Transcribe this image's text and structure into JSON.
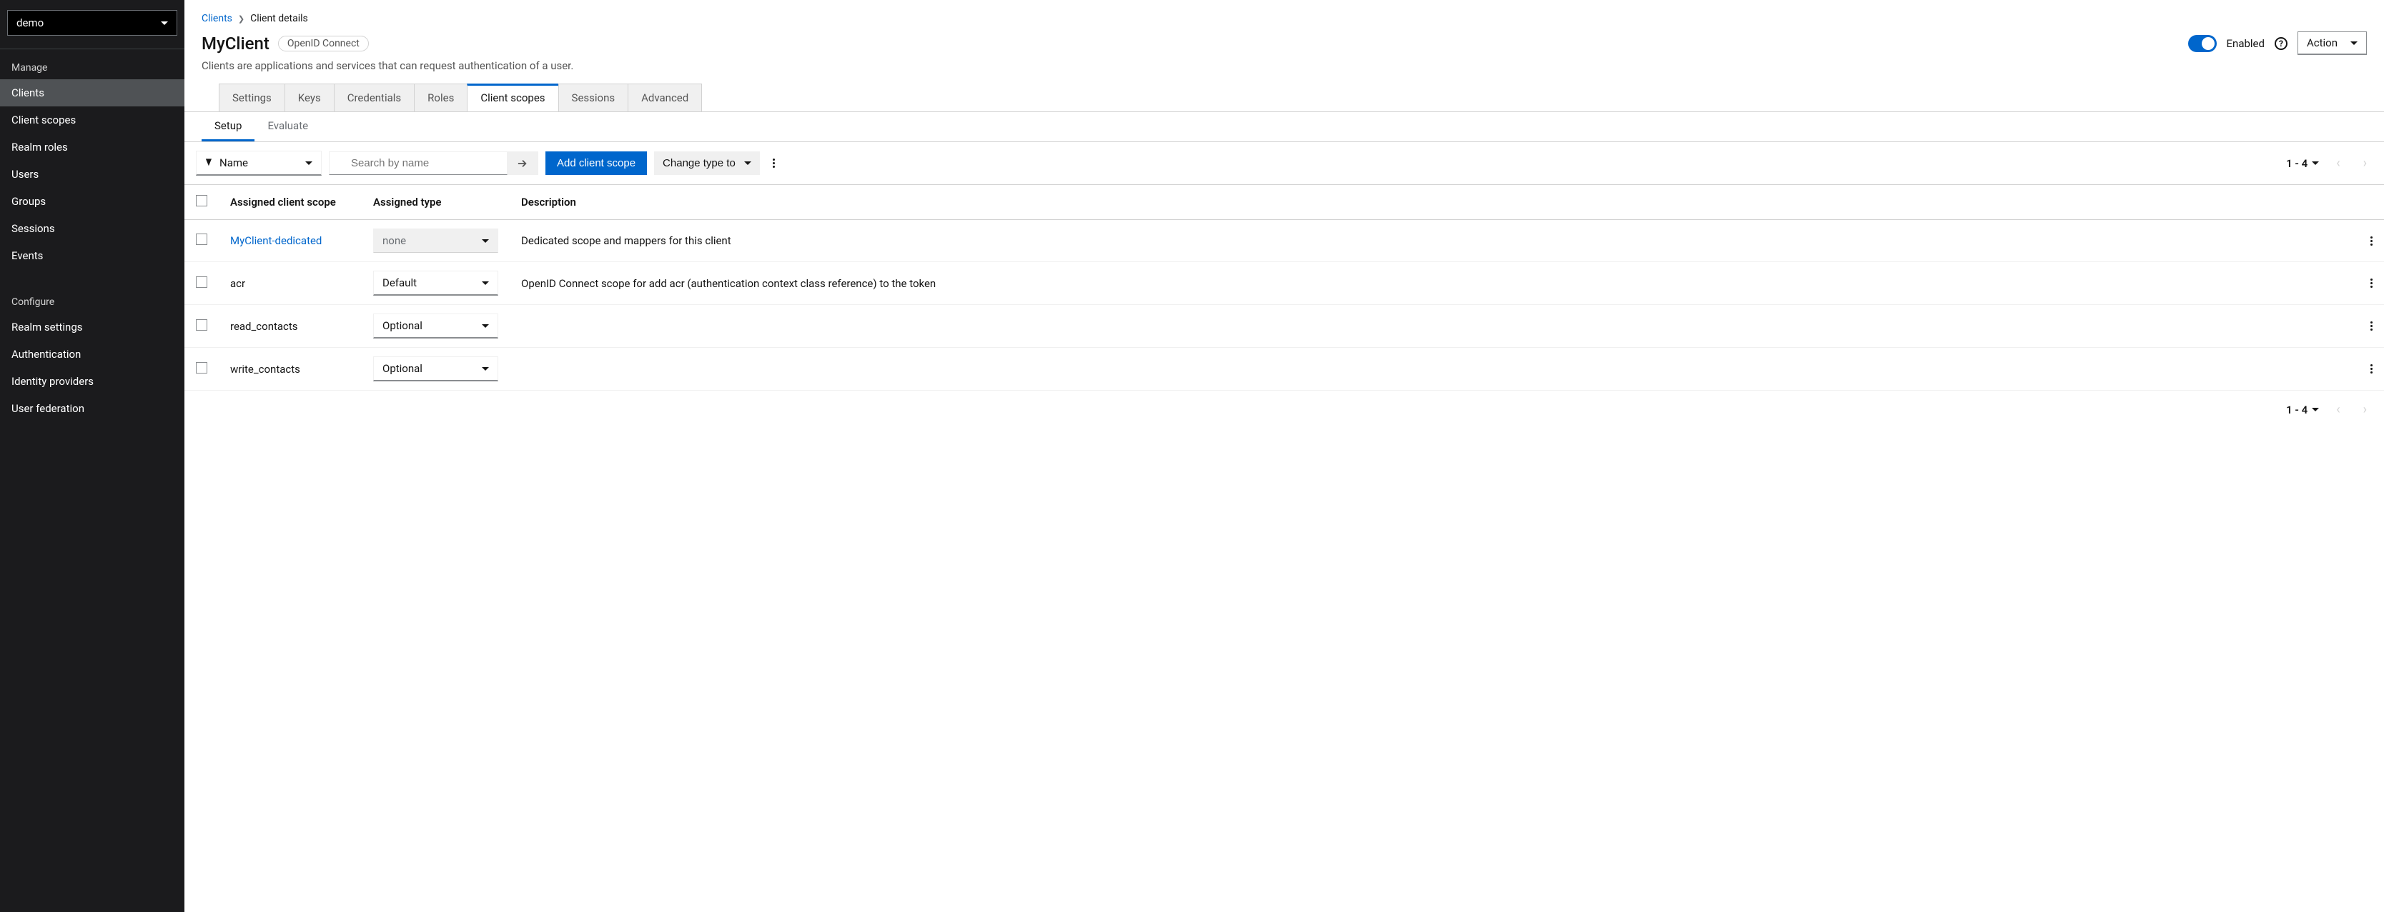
{
  "sidebar": {
    "realm": "demo",
    "sections": {
      "manage": {
        "label": "Manage",
        "items": [
          "Clients",
          "Client scopes",
          "Realm roles",
          "Users",
          "Groups",
          "Sessions",
          "Events"
        ]
      },
      "configure": {
        "label": "Configure",
        "items": [
          "Realm settings",
          "Authentication",
          "Identity providers",
          "User federation"
        ]
      }
    }
  },
  "breadcrumb": {
    "link": "Clients",
    "current": "Client details"
  },
  "header": {
    "title": "MyClient",
    "badge": "OpenID Connect",
    "description": "Clients are applications and services that can request authentication of a user.",
    "enabled_label": "Enabled",
    "action_label": "Action"
  },
  "tabs": [
    "Settings",
    "Keys",
    "Credentials",
    "Roles",
    "Client scopes",
    "Sessions",
    "Advanced"
  ],
  "active_tab": "Client scopes",
  "subtabs": [
    "Setup",
    "Evaluate"
  ],
  "active_subtab": "Setup",
  "toolbar": {
    "filter_label": "Name",
    "search_placeholder": "Search by name",
    "add_label": "Add client scope",
    "change_type_label": "Change type to",
    "page_info": "1 - 4"
  },
  "table": {
    "headers": {
      "scope": "Assigned client scope",
      "type": "Assigned type",
      "desc": "Description"
    },
    "rows": [
      {
        "scope": "MyClient-dedicated",
        "is_link": true,
        "type": "none",
        "type_disabled": true,
        "desc": "Dedicated scope and mappers for this client"
      },
      {
        "scope": "acr",
        "is_link": false,
        "type": "Default",
        "type_disabled": false,
        "desc": "OpenID Connect scope for add acr (authentication context class reference) to the token"
      },
      {
        "scope": "read_contacts",
        "is_link": false,
        "type": "Optional",
        "type_disabled": false,
        "desc": ""
      },
      {
        "scope": "write_contacts",
        "is_link": false,
        "type": "Optional",
        "type_disabled": false,
        "desc": ""
      }
    ]
  },
  "footer": {
    "page_info": "1 - 4"
  }
}
